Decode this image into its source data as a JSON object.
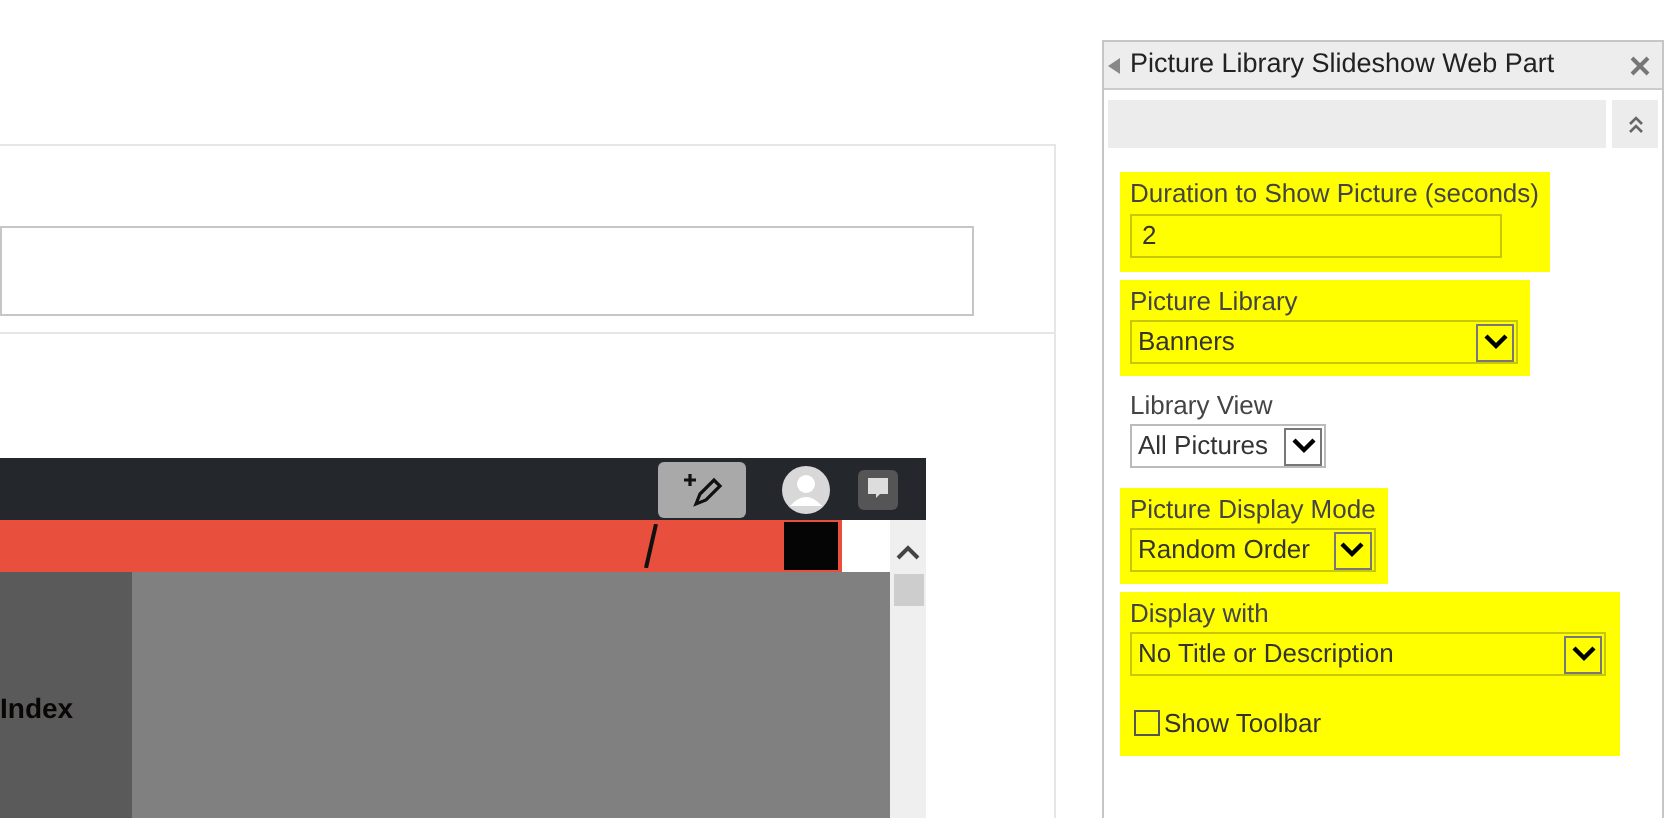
{
  "preview": {
    "sidebar_label": "Index"
  },
  "panel": {
    "title": "Picture Library Slideshow Web Part",
    "fields": [
      {
        "kind": "text",
        "label": "Duration to Show Picture (seconds)",
        "value": "2",
        "highlighted": true
      },
      {
        "kind": "select",
        "label": "Picture Library",
        "value": "Banners",
        "highlighted": true
      },
      {
        "kind": "select",
        "label": "Library View",
        "value": "All Pictures",
        "highlighted": false
      },
      {
        "kind": "select",
        "label": "Picture Display Mode",
        "value": "Random Order",
        "highlighted": true
      },
      {
        "kind": "select",
        "label": "Display with",
        "value": "No Title or Description",
        "highlighted": true,
        "checkbox": {
          "label": "Show Toolbar",
          "checked": false
        }
      }
    ]
  }
}
